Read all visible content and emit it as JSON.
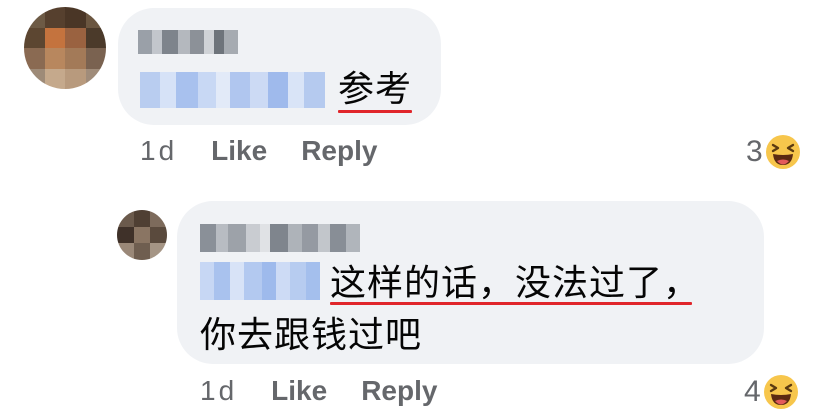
{
  "comments": [
    {
      "text": "参考",
      "timestamp": "1d",
      "like_label": "Like",
      "reply_label": "Reply",
      "reaction_count": "3",
      "reaction_icon": "haha-emoji-icon"
    },
    {
      "text_line1": "这样的话，没法过了，",
      "text_line2": "你去跟钱过吧",
      "timestamp": "1d",
      "like_label": "Like",
      "reply_label": "Reply",
      "reaction_count": "4",
      "reaction_icon": "haha-emoji-icon"
    }
  ],
  "colors": {
    "bubble_bg": "#f0f2f5",
    "meta_text": "#65676b",
    "body_text": "#050505",
    "spellcheck_underline": "#e0262b",
    "haha_yellow": "#f7c64c"
  }
}
